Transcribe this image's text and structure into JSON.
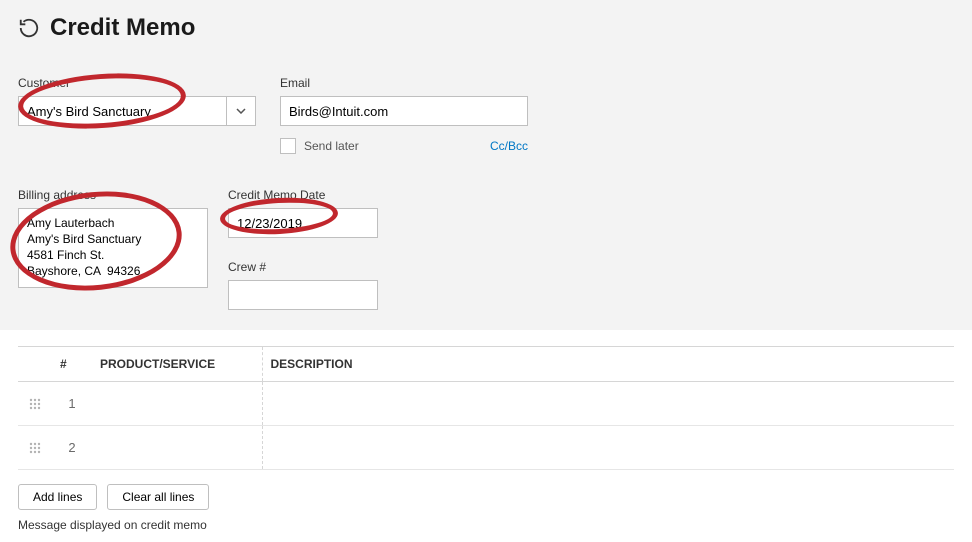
{
  "header": {
    "title": "Credit Memo"
  },
  "customer": {
    "label": "Customer",
    "value": "Amy's Bird Sanctuary"
  },
  "email": {
    "label": "Email",
    "value": "Birds@Intuit.com",
    "send_later_label": "Send later",
    "ccbcc_label": "Cc/Bcc"
  },
  "billing": {
    "label": "Billing address",
    "value": "Amy Lauterbach\nAmy's Bird Sanctuary\n4581 Finch St.\nBayshore, CA  94326"
  },
  "date": {
    "label": "Credit Memo Date",
    "value": "12/23/2019"
  },
  "crew": {
    "label": "Crew #",
    "value": ""
  },
  "table": {
    "headers": {
      "num": "#",
      "product": "PRODUCT/SERVICE",
      "description": "DESCRIPTION"
    },
    "rows": [
      {
        "num": "1"
      },
      {
        "num": "2"
      }
    ]
  },
  "buttons": {
    "add_lines": "Add lines",
    "clear_all": "Clear all lines"
  },
  "footer": {
    "message_label": "Message displayed on credit memo"
  }
}
